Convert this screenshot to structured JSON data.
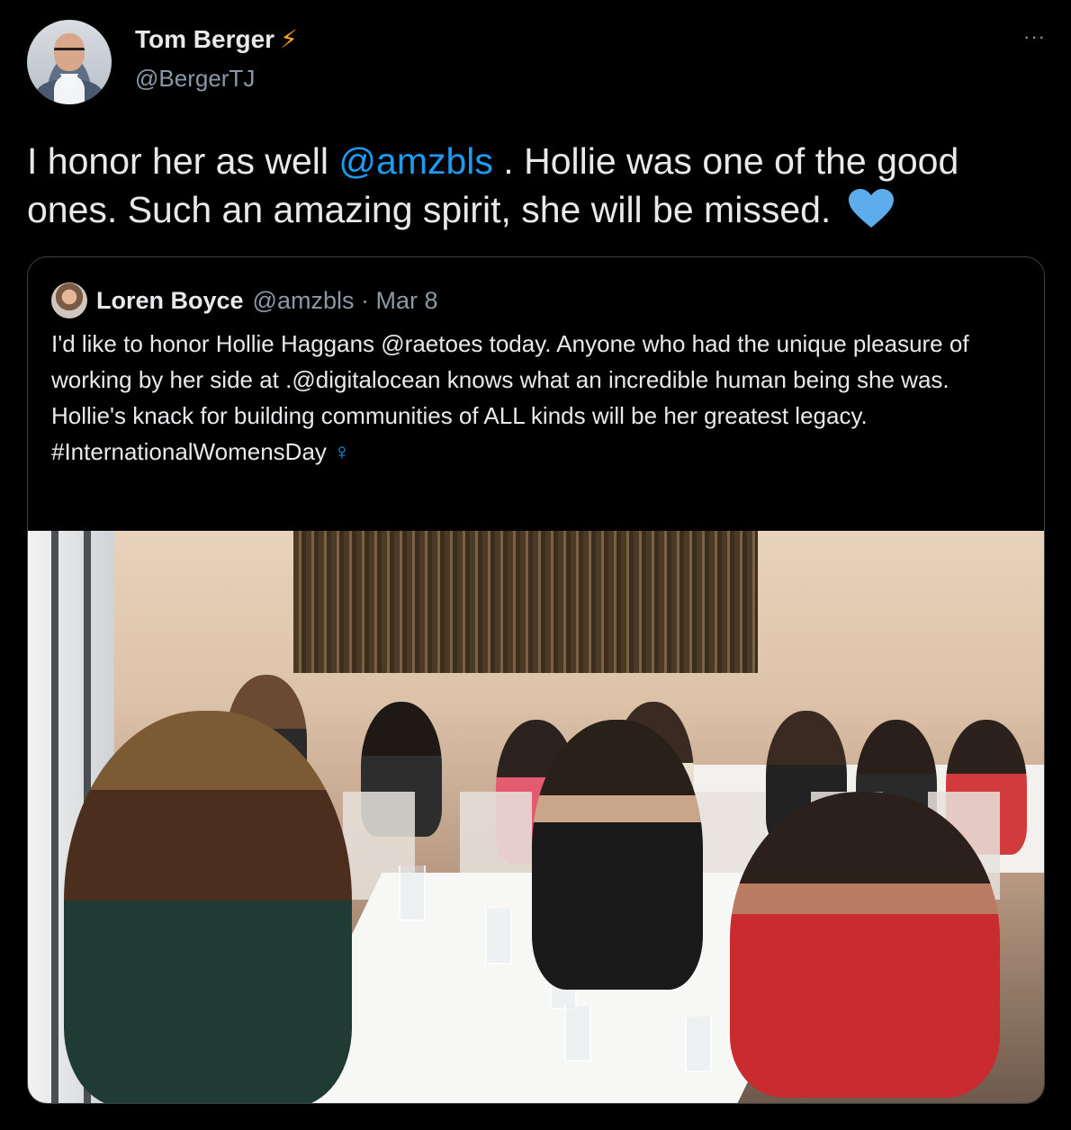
{
  "author": {
    "name": "Tom Berger",
    "badge_icon": "lightning-bolt-icon",
    "badge_glyph": "⚡",
    "handle": "@BergerTJ"
  },
  "more_glyph": "···",
  "tweet": {
    "text_before": "I honor her as well ",
    "mention": "@amzbls",
    "text_after": " . Hollie was one of the good ones. Such an amazing spirit, she will be missed. ",
    "emoji_icon": "blue-heart-icon"
  },
  "quoted": {
    "name": "Loren Boyce",
    "handle": "@amzbls",
    "separator": " · ",
    "date": "Mar 8",
    "text": "I'd like to honor Hollie Haggans @raetoes today.  Anyone who had the unique pleasure of working by her side at .@digitalocean knows what an incredible human being she was. Hollie's knack for building communities of ALL kinds will be her greatest legacy.\n#InternationalWomensDay ",
    "venus_glyph": "♀"
  },
  "colors": {
    "background": "#000000",
    "text": "#e7e9ea",
    "secondary": "#8b98a5",
    "link": "#1d9bf0",
    "border": "#3e4144"
  }
}
